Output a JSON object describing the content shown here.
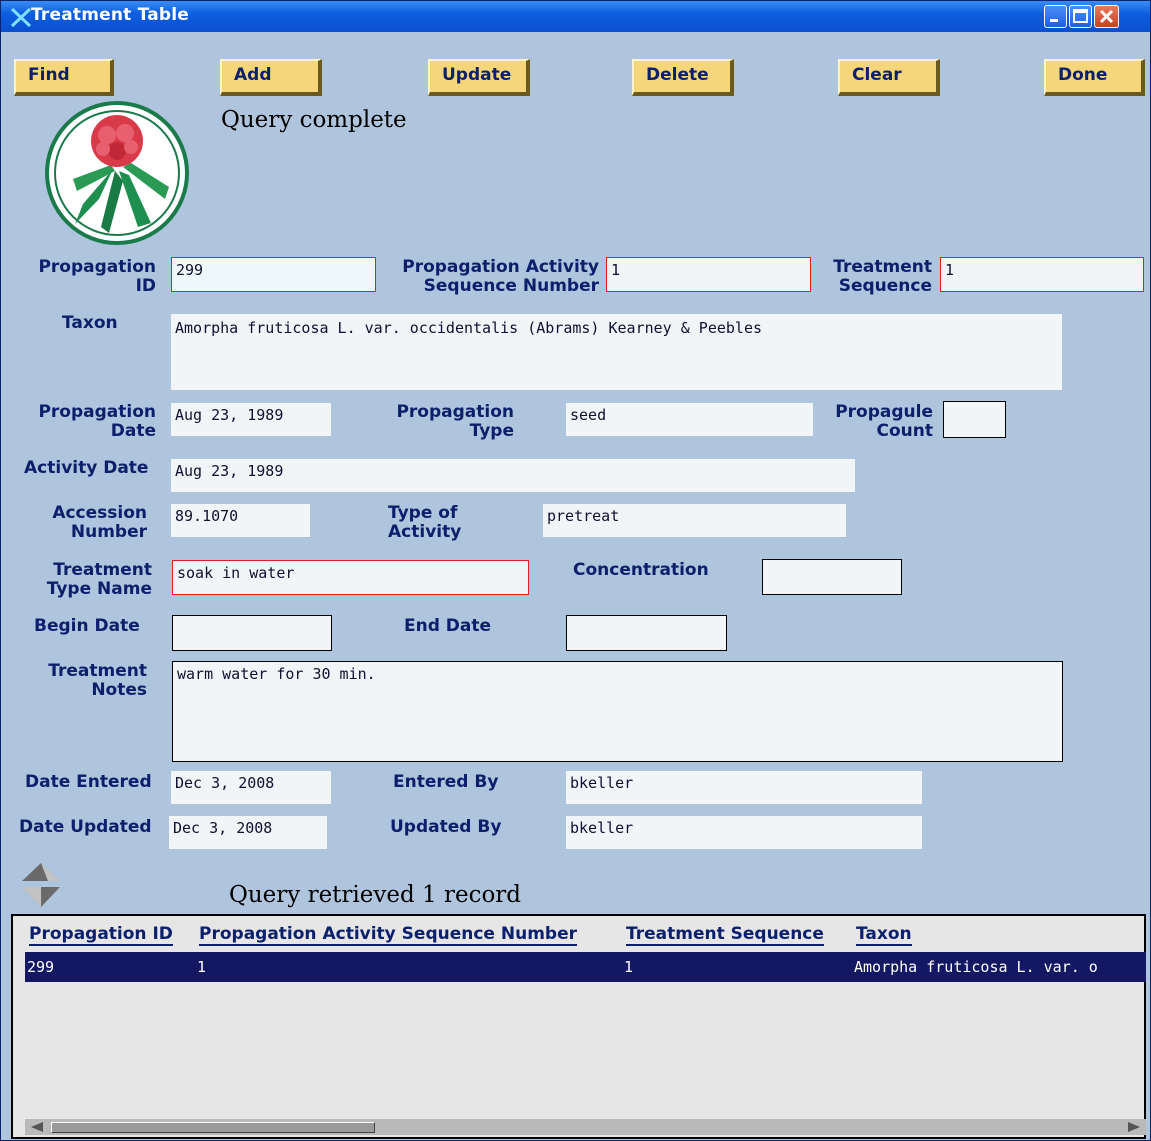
{
  "window": {
    "title": "Treatment Table"
  },
  "toolbar": {
    "find": "Find",
    "add": "Add",
    "update": "Update",
    "delete": "Delete",
    "clear": "Clear",
    "done": "Done"
  },
  "status": "Query complete",
  "labels": {
    "prop_id_1": "Propagation",
    "prop_id_2": "ID",
    "act_seq_1": "Propagation Activity",
    "act_seq_2": "Sequence Number",
    "treat_seq_1": "Treatment",
    "treat_seq_2": "Sequence",
    "taxon": "Taxon",
    "prop_date_1": "Propagation",
    "prop_date_2": "Date",
    "prop_type_1": "Propagation",
    "prop_type_2": "Type",
    "count_1": "Propagule",
    "count_2": "Count",
    "activity_date": "Activity Date",
    "acc_1": "Accession",
    "acc_2": "Number",
    "type_act_1": "Type of",
    "type_act_2": "Activity",
    "ttype_1": "Treatment",
    "ttype_2": "Type Name",
    "concentration": "Concentration",
    "begin_date": "Begin Date",
    "end_date": "End Date",
    "notes_1": "Treatment",
    "notes_2": "Notes",
    "date_entered": "Date Entered",
    "entered_by": "Entered By",
    "date_updated": "Date Updated",
    "updated_by": "Updated By"
  },
  "fields": {
    "propagation_id": "299",
    "activity_sequence": "1",
    "treatment_sequence": "1",
    "taxon": "Amorpha fruticosa L. var. occidentalis (Abrams) Kearney & Peebles",
    "propagation_date": "Aug 23, 1989",
    "propagation_type": "seed",
    "propagule_count": "",
    "activity_date": "Aug 23, 1989",
    "accession_number": "89.1070",
    "type_of_activity": "pretreat",
    "treatment_type_name": "soak in water",
    "concentration": "",
    "begin_date": "",
    "end_date": "",
    "treatment_notes": "warm water for 30 min.",
    "date_entered": "Dec  3, 2008",
    "entered_by": "bkeller",
    "date_updated": "Dec  3, 2008",
    "updated_by": "bkeller"
  },
  "record_status": "Query retrieved 1 record",
  "list": {
    "headers": [
      "Propagation ID",
      "Propagation Activity Sequence Number",
      "Treatment Sequence",
      "Taxon"
    ],
    "rows": [
      [
        "299",
        "1",
        "1",
        "Amorpha fruticosa L. var. o"
      ]
    ]
  },
  "colors": {
    "background": "#afc4dd",
    "label": "#0b1f6b",
    "button": "#f6d67a",
    "selected_row": "#141862",
    "required_border": "#e02020"
  },
  "icons": {
    "app": "x-icon",
    "logo": "flower-emblem-icon",
    "nav": "up-down-arrows-icon"
  }
}
